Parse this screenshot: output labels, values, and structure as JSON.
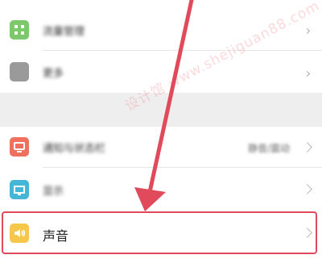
{
  "settings": {
    "rows": [
      {
        "label": "流量管理",
        "icon": "app-grid-icon",
        "color": "#7cc86a"
      },
      {
        "label": "更多",
        "icon": "more-icon",
        "color": "#9a9a9a"
      },
      {
        "label": "通知与状态栏",
        "icon": "notification-icon",
        "color": "#f0705f",
        "value": "静音/震动"
      },
      {
        "label": "显示",
        "icon": "display-icon",
        "color": "#45b6d8"
      },
      {
        "label": "声音",
        "icon": "speaker-icon",
        "color": "#f5c74a"
      }
    ]
  },
  "watermark": {
    "text": "设计馆 www.shejiguan88.com"
  },
  "annotation": {
    "arrow_color": "#e04a5a"
  }
}
